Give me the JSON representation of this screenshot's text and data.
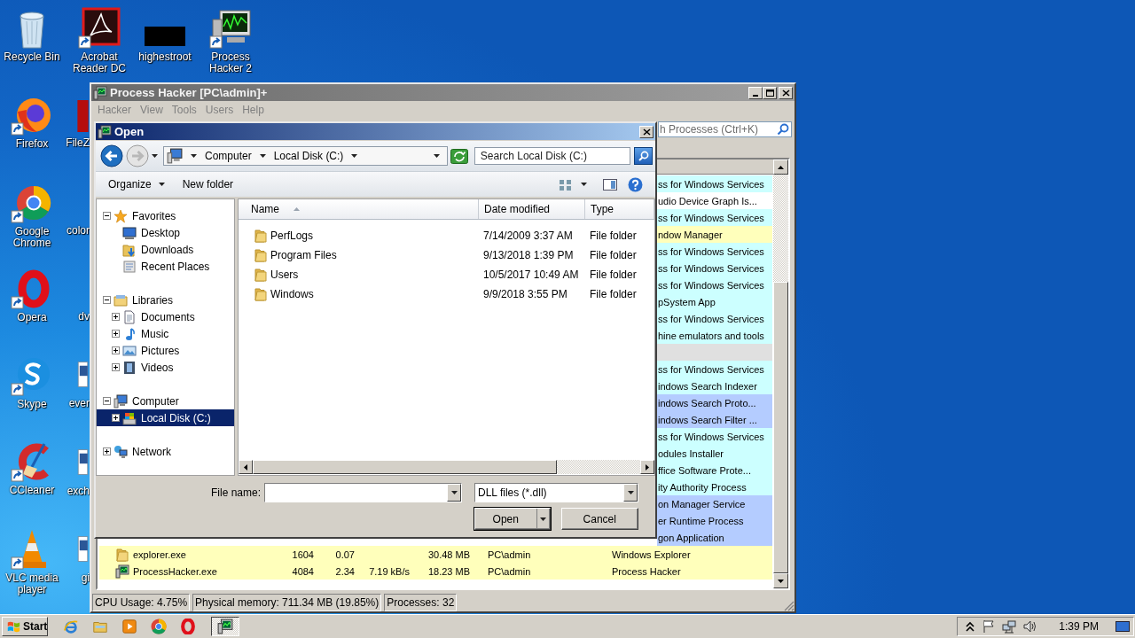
{
  "desktop": {
    "icons": [
      {
        "label": "Recycle Bin",
        "kind": "recycle-bin",
        "shortcut": false
      },
      {
        "label": "Acrobat Reader DC",
        "kind": "acrobat",
        "shortcut": true
      },
      {
        "label": "highestroot",
        "kind": "thumbnail",
        "shortcut": false
      },
      {
        "label": "Process Hacker 2",
        "kind": "process-hacker",
        "shortcut": true
      },
      {
        "label": "Firefox",
        "kind": "firefox",
        "shortcut": true
      },
      {
        "label": "FileZ",
        "kind": "app"
      },
      {
        "label": "Google Chrome",
        "kind": "chrome",
        "shortcut": true
      },
      {
        "label": "color"
      },
      {
        "label": "Opera",
        "kind": "opera",
        "shortcut": true
      },
      {
        "label": "dv"
      },
      {
        "label": "Skype",
        "kind": "skype",
        "shortcut": true
      },
      {
        "label": "ever",
        "kind": "document"
      },
      {
        "label": "CCleaner",
        "kind": "ccleaner",
        "shortcut": true
      },
      {
        "label": "exch",
        "kind": "document"
      },
      {
        "label": "VLC media player",
        "kind": "vlc",
        "shortcut": true
      },
      {
        "label": "gi",
        "kind": "document"
      }
    ]
  },
  "process_hacker": {
    "title": "Process Hacker [PC\\admin]+",
    "menu": [
      "Hacker",
      "View",
      "Tools",
      "Users",
      "Help"
    ],
    "search": {
      "placeholder": "h Processes (Ctrl+K)"
    },
    "processes": [
      {
        "description": "ss for Windows Services",
        "color": "#ccffff"
      },
      {
        "description": "udio Device Graph Is...",
        "color": "#ffffff"
      },
      {
        "description": "ss for Windows Services",
        "color": "#ccffff"
      },
      {
        "description": "ndow Manager",
        "color": "#ffffbb"
      },
      {
        "description": "ss for Windows Services",
        "color": "#ccffff"
      },
      {
        "description": "ss for Windows Services",
        "color": "#ccffff"
      },
      {
        "description": "ss for Windows Services",
        "color": "#ccffff"
      },
      {
        "description": "pSystem App",
        "color": "#ccffff"
      },
      {
        "description": "ss for Windows Services",
        "color": "#ccffff"
      },
      {
        "description": "hine emulators and tools",
        "color": "#ccffff"
      },
      {
        "color": "#e0e0e0"
      },
      {
        "description": "ss for Windows Services",
        "color": "#ccffff"
      },
      {
        "description": "indows Search Indexer",
        "color": "#ccffff"
      },
      {
        "description": "indows Search Proto...",
        "color": "#b4ccff"
      },
      {
        "description": "indows Search Filter ...",
        "color": "#b4ccff"
      },
      {
        "description": "ss for Windows Services",
        "color": "#ccffff"
      },
      {
        "description": "odules Installer",
        "color": "#ccffff"
      },
      {
        "description": "ffice Software Prote...",
        "color": "#ccffff"
      },
      {
        "description": "ity Authority Process",
        "color": "#ccffff"
      },
      {
        "description": "on Manager Service",
        "color": "#b4ccff"
      },
      {
        "description": "er Runtime Process",
        "color": "#b4ccff"
      },
      {
        "description": "gon Application",
        "color": "#b4ccff"
      },
      {
        "name": "explorer.exe",
        "kind": "folder",
        "pid": "1604",
        "cpu": "0.07",
        "memory": "30.48 MB",
        "user": "PC\\admin",
        "description": "Windows Explorer",
        "color": "#ffffbb"
      },
      {
        "name": "ProcessHacker.exe",
        "kind": "process-hacker",
        "pid": "4084",
        "cpu": "2.34",
        "io": "7.19 kB/s",
        "memory": "18.23 MB",
        "user": "PC\\admin",
        "description": "Process Hacker",
        "color": "#ffffbb"
      }
    ],
    "status_bar": [
      "CPU Usage: 4.75%",
      "Physical memory: 711.34 MB (19.85%)",
      "Processes: 32"
    ]
  },
  "open_dialog": {
    "title": "Open",
    "breadcrumb": [
      "Computer",
      "Local Disk (C:)"
    ],
    "search": {
      "placeholder": "Search Local Disk (C:)"
    },
    "toolbar": [
      {
        "label": "Organize",
        "dropdown": true
      },
      {
        "label": "New folder",
        "dropdown": false
      }
    ],
    "nav_tree": [
      {
        "label": "Favorites",
        "kind": "star",
        "expanded": true,
        "selected": false,
        "children": [
          {
            "label": "Desktop",
            "kind": "desktop",
            "selected": false
          },
          {
            "label": "Downloads",
            "kind": "downloads",
            "selected": false
          },
          {
            "label": "Recent Places",
            "kind": "recent",
            "selected": false
          }
        ]
      },
      {
        "label": "Libraries",
        "kind": "library",
        "expanded": true,
        "selected": false,
        "children": [
          {
            "label": "Documents",
            "kind": "document",
            "expanded": false,
            "selected": false
          },
          {
            "label": "Music",
            "kind": "music",
            "expanded": false,
            "selected": false
          },
          {
            "label": "Pictures",
            "kind": "pictures",
            "expanded": false,
            "selected": false
          },
          {
            "label": "Videos",
            "kind": "videos",
            "expanded": false,
            "selected": false
          }
        ]
      },
      {
        "label": "Computer",
        "kind": "computer",
        "expanded": true,
        "selected": false,
        "children": [
          {
            "label": "Local Disk (C:)",
            "kind": "disk",
            "expanded": false,
            "selected": true
          }
        ]
      },
      {
        "label": "Network",
        "kind": "network",
        "expanded": false,
        "selected": false
      }
    ],
    "columns": [
      {
        "label": "Name",
        "sorted": true
      },
      {
        "label": "Date modified",
        "sorted": false
      },
      {
        "label": "Type",
        "sorted": false
      }
    ],
    "files": [
      {
        "name": "PerfLogs",
        "date": "7/14/2009 3:37 AM",
        "type": "File folder"
      },
      {
        "name": "Program Files",
        "date": "9/13/2018 1:39 PM",
        "type": "File folder"
      },
      {
        "name": "Users",
        "date": "10/5/2017 10:49 AM",
        "type": "File folder"
      },
      {
        "name": "Windows",
        "date": "9/9/2018 3:55 PM",
        "type": "File folder"
      }
    ],
    "file_name": {
      "label": "File name:"
    },
    "file_type": "DLL files (*.dll)",
    "buttons": [
      {
        "label": "Open",
        "kind": "split"
      },
      {
        "label": "Cancel",
        "kind": "plain"
      }
    ]
  },
  "taskbar": {
    "start": "Start",
    "items": [
      {
        "kind": "ie",
        "selected": false
      },
      {
        "kind": "explorer",
        "selected": false
      },
      {
        "kind": "media-player",
        "selected": false
      },
      {
        "kind": "chrome",
        "selected": false
      },
      {
        "kind": "opera",
        "selected": false
      },
      {
        "kind": "process-hacker",
        "selected": true
      }
    ],
    "clock": "1:39 PM"
  }
}
